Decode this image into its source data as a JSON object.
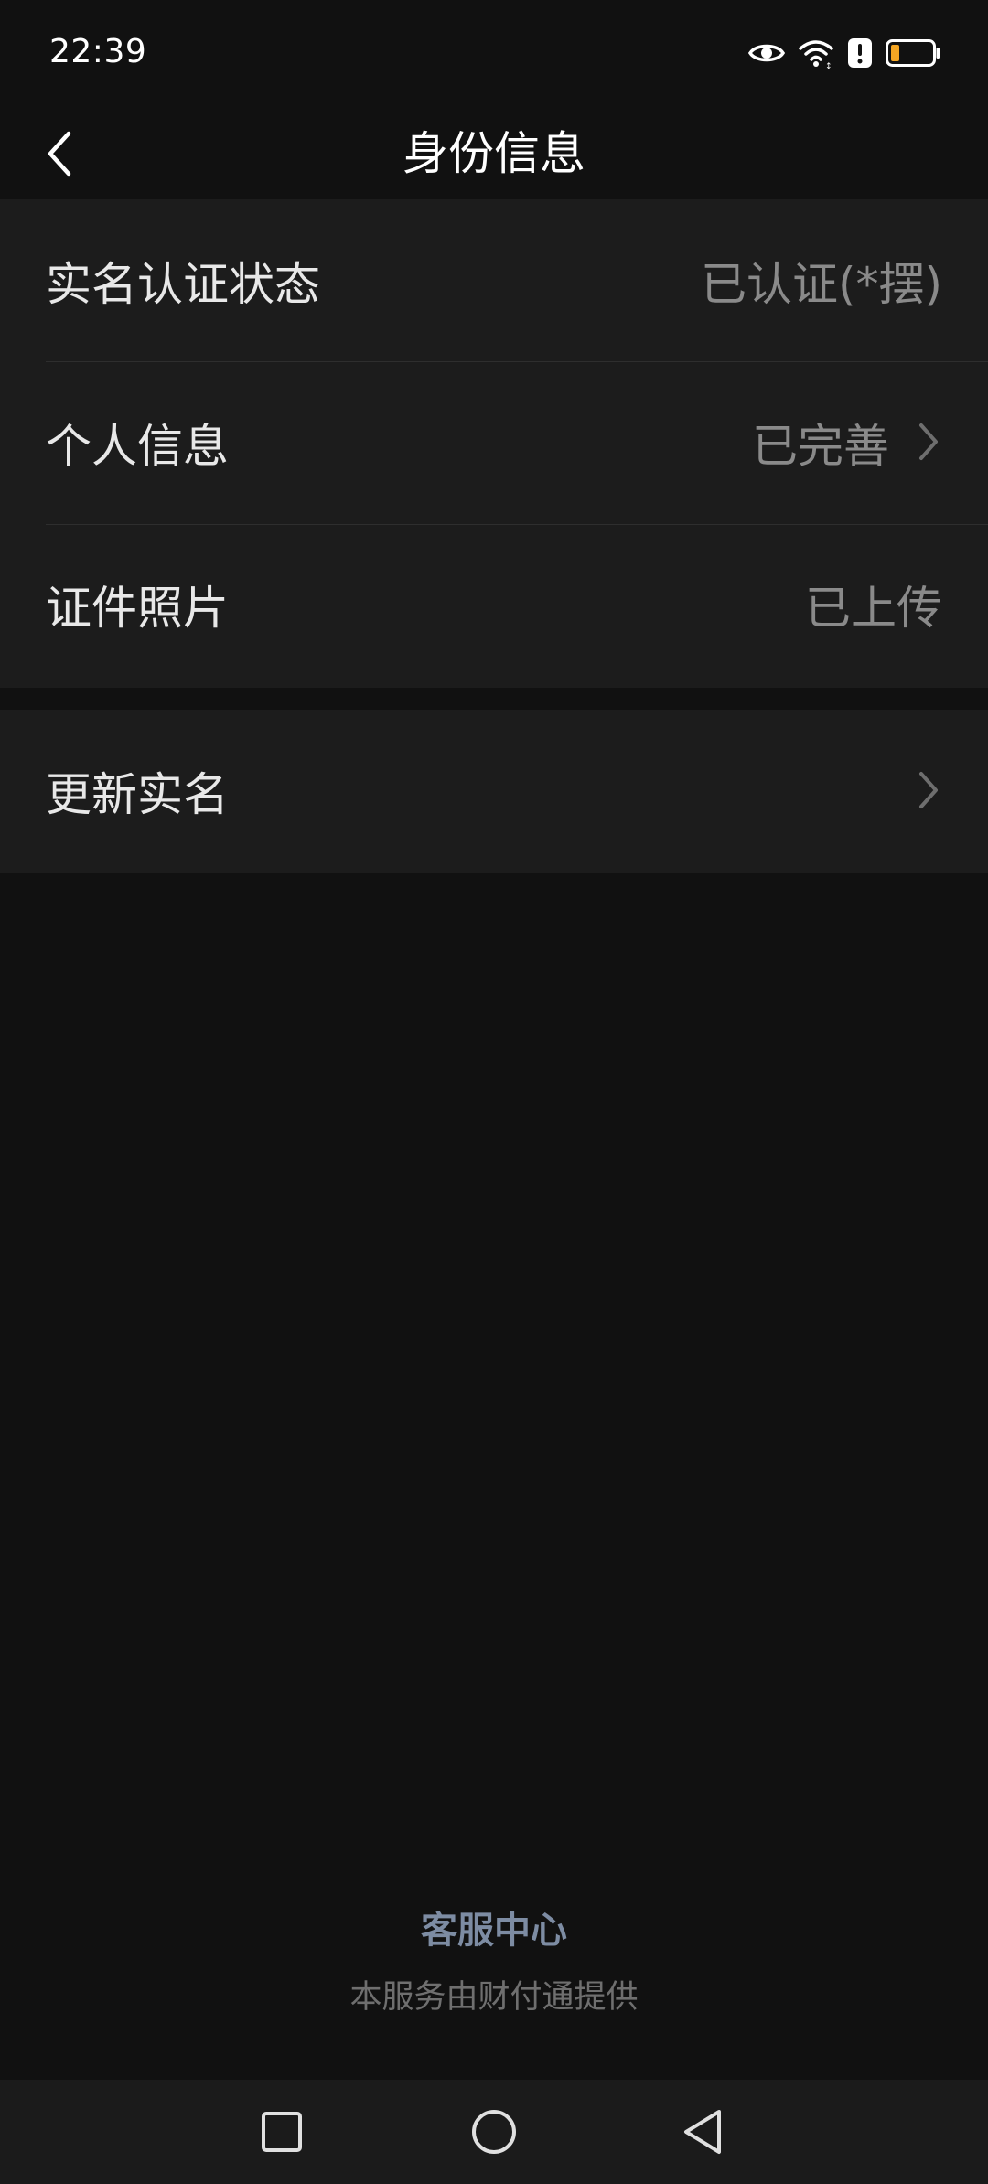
{
  "status_bar": {
    "time": "22:39",
    "icons": [
      "eye-icon",
      "wifi-icon",
      "alert-icon",
      "battery-icon"
    ],
    "battery_color": "#f5a623"
  },
  "header": {
    "title": "身份信息",
    "back_icon": "chevron-left-icon"
  },
  "identity_group": {
    "items": [
      {
        "label": "实名认证状态",
        "value": "已认证(*摆)"
      },
      {
        "label": "个人信息",
        "value": "已完善",
        "icon": "chevron-right-icon"
      },
      {
        "label": "证件照片",
        "value": "已上传"
      }
    ]
  },
  "update_group": {
    "items": [
      {
        "label": "更新实名",
        "icon": "chevron-right-icon"
      }
    ]
  },
  "footer": {
    "link": "客服中心",
    "note": "本服务由财付通提供"
  },
  "system_nav": {
    "buttons": [
      "recent-apps-icon",
      "home-icon",
      "back-triangle-icon"
    ]
  },
  "colors": {
    "background": "#111111",
    "card": "#1c1c1c",
    "link": "#7d8ca3"
  }
}
